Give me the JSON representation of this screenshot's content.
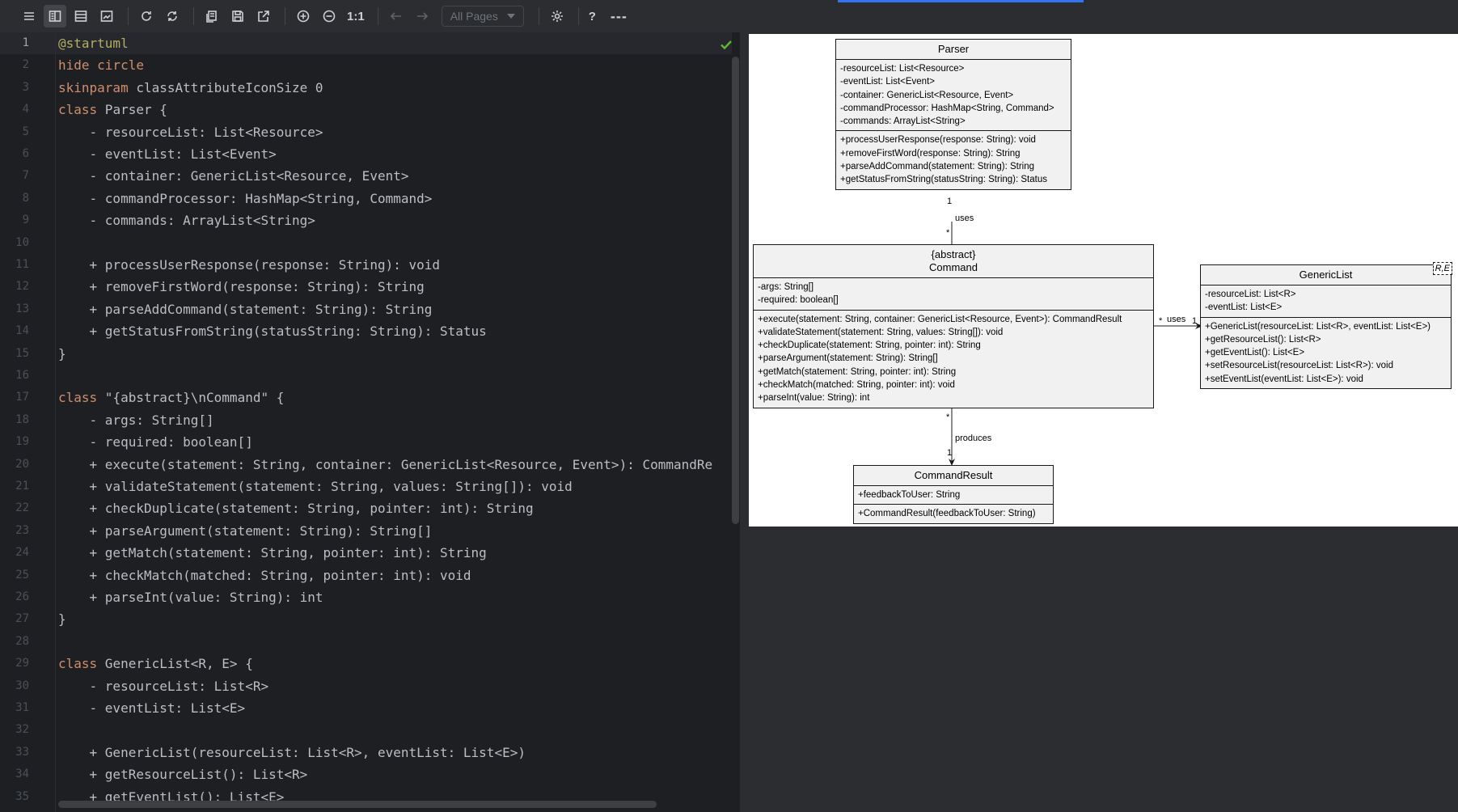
{
  "toolbar": {
    "buttons": [
      {
        "id": "menu",
        "icon": "menu-icon"
      },
      {
        "id": "split",
        "icon": "split-view-icon",
        "active": true
      },
      {
        "id": "editor-only",
        "icon": "editor-only-icon"
      },
      {
        "id": "preview-only",
        "icon": "preview-only-icon"
      },
      {
        "id": "refresh",
        "icon": "refresh-icon"
      },
      {
        "id": "auto-refresh",
        "icon": "auto-refresh-icon"
      },
      {
        "id": "copy",
        "icon": "copy-icon"
      },
      {
        "id": "save",
        "icon": "save-icon"
      },
      {
        "id": "open-external",
        "icon": "open-external-icon"
      },
      {
        "id": "zoom-in",
        "icon": "zoom-in-icon"
      },
      {
        "id": "zoom-out",
        "icon": "zoom-out-icon"
      }
    ],
    "zoom_reset_label": "1:1",
    "page_select_value": "All Pages",
    "help_label": "?",
    "more_label": "---"
  },
  "editor": {
    "status": "ok",
    "current_line": 1,
    "lines": [
      [
        {
          "t": "@startuml",
          "c": "ann"
        }
      ],
      [
        {
          "t": "hide circle",
          "c": "kw"
        }
      ],
      [
        {
          "t": "skinparam",
          "c": "kw"
        },
        {
          "t": " classAttributeIconSize 0"
        }
      ],
      [
        {
          "t": "class",
          "c": "kw"
        },
        {
          "t": " Parser {"
        }
      ],
      [
        {
          "t": "    - resourceList: List<Resource>"
        }
      ],
      [
        {
          "t": "    - eventList: List<Event>"
        }
      ],
      [
        {
          "t": "    - container: GenericList<Resource, Event>"
        }
      ],
      [
        {
          "t": "    - commandProcessor: HashMap<String, Command>"
        }
      ],
      [
        {
          "t": "    - commands: ArrayList<String>"
        }
      ],
      [
        {
          "t": ""
        }
      ],
      [
        {
          "t": "    + processUserResponse(response: String): void"
        }
      ],
      [
        {
          "t": "    + removeFirstWord(response: String): String"
        }
      ],
      [
        {
          "t": "    + parseAddCommand(statement: String): String"
        }
      ],
      [
        {
          "t": "    + getStatusFromString(statusString: String): Status"
        }
      ],
      [
        {
          "t": "}"
        }
      ],
      [
        {
          "t": ""
        }
      ],
      [
        {
          "t": "class",
          "c": "kw"
        },
        {
          "t": " \"{abstract}\\nCommand\" {"
        }
      ],
      [
        {
          "t": "    - args: String[]"
        }
      ],
      [
        {
          "t": "    - required: boolean[]"
        }
      ],
      [
        {
          "t": "    + execute(statement: String, container: GenericList<Resource, Event>): CommandRe"
        }
      ],
      [
        {
          "t": "    + validateStatement(statement: String, values: String[]): void"
        }
      ],
      [
        {
          "t": "    + checkDuplicate(statement: String, pointer: int): String"
        }
      ],
      [
        {
          "t": "    + parseArgument(statement: String): String[]"
        }
      ],
      [
        {
          "t": "    + getMatch(statement: String, pointer: int): String"
        }
      ],
      [
        {
          "t": "    + checkMatch(matched: String, pointer: int): void"
        }
      ],
      [
        {
          "t": "    + parseInt(value: String): int"
        }
      ],
      [
        {
          "t": "}"
        }
      ],
      [
        {
          "t": ""
        }
      ],
      [
        {
          "t": "class",
          "c": "kw"
        },
        {
          "t": " GenericList<R, E> {"
        }
      ],
      [
        {
          "t": "    - resourceList: List<R>"
        }
      ],
      [
        {
          "t": "    - eventList: List<E>"
        }
      ],
      [
        {
          "t": ""
        }
      ],
      [
        {
          "t": "    + GenericList(resourceList: List<R>, eventList: List<E>)"
        }
      ],
      [
        {
          "t": "    + getResourceList(): List<R>"
        }
      ],
      [
        {
          "t": "    + getEventList(): List<E>"
        }
      ]
    ]
  },
  "diagram": {
    "classes": {
      "parser": {
        "title": [
          "Parser"
        ],
        "fields": [
          "-resourceList: List<Resource>",
          "-eventList: List<Event>",
          "-container: GenericList<Resource, Event>",
          "-commandProcessor: HashMap<String, Command>",
          "-commands: ArrayList<String>"
        ],
        "methods": [
          "+processUserResponse(response: String): void",
          "+removeFirstWord(response: String): String",
          "+parseAddCommand(statement: String): String",
          "+getStatusFromString(statusString: String): Status"
        ]
      },
      "command": {
        "title": [
          "{abstract}",
          "Command"
        ],
        "fields": [
          "-args: String[]",
          "-required: boolean[]"
        ],
        "methods": [
          "+execute(statement: String, container: GenericList<Resource, Event>): CommandResult",
          "+validateStatement(statement: String, values: String[]): void",
          "+checkDuplicate(statement: String, pointer: int): String",
          "+parseArgument(statement: String): String[]",
          "+getMatch(statement: String, pointer: int): String",
          "+checkMatch(matched: String, pointer: int): void",
          "+parseInt(value: String): int"
        ]
      },
      "genericlist": {
        "title": [
          "GenericList"
        ],
        "type_params": "R,E",
        "fields": [
          "-resourceList: List<R>",
          "-eventList: List<E>"
        ],
        "methods": [
          "+GenericList(resourceList: List<R>, eventList: List<E>)",
          "+getResourceList(): List<R>",
          "+getEventList(): List<E>",
          "+setResourceList(resourceList: List<R>): void",
          "+setEventList(eventList: List<E>): void"
        ]
      },
      "commandresult": {
        "title": [
          "CommandResult"
        ],
        "fields": [
          "+feedbackToUser: String"
        ],
        "methods": [
          "+CommandResult(feedbackToUser: String)"
        ]
      }
    },
    "edges": {
      "parser_command": {
        "label": "uses",
        "from_mult": "1",
        "to_mult": "*"
      },
      "command_genericlist": {
        "label": "uses",
        "from_mult": "*",
        "to_mult": "1"
      },
      "command_result": {
        "label": "produces",
        "from_mult": "*",
        "to_mult": "1"
      }
    }
  }
}
